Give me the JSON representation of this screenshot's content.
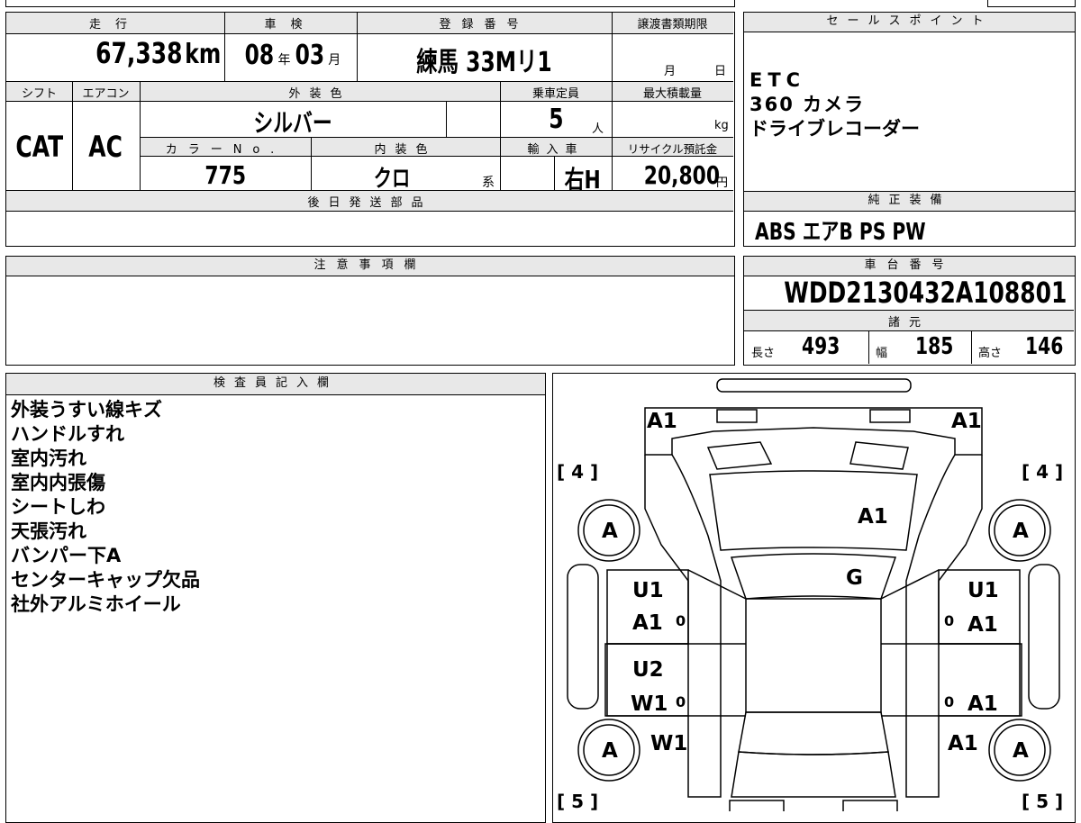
{
  "main": {
    "mileage_label": "走行",
    "mileage": "67,338",
    "mileage_unit": "km",
    "inspection_label": "車検",
    "inspection_year": "08",
    "year_unit": "年",
    "inspection_month": "03",
    "month_unit": "月",
    "registration_label": "登録番号",
    "registration": "練馬 33Mリ1",
    "transfer_deadline_label": "譲渡書類期限",
    "transfer_month_unit": "月",
    "transfer_day_unit": "日",
    "shift_label": "シフト",
    "shift": "CAT",
    "aircon_label": "エアコン",
    "aircon": "AC",
    "exterior_color_label": "外装色",
    "exterior_color": "シルバー",
    "capacity_label": "乗車定員",
    "capacity": "5",
    "capacity_unit": "人",
    "max_load_label": "最大積載量",
    "max_load_unit": "kg",
    "color_no_label": "カラーNo.",
    "color_no": "775",
    "interior_color_label": "内装色",
    "interior_color": "クロ",
    "interior_suffix": "系",
    "import_label": "輸入車",
    "import_value": "右H",
    "recycle_label": "リサイクル預託金",
    "recycle_fee": "20,800",
    "recycle_unit": "円",
    "later_parts_label": "後日発送部品"
  },
  "sales_points": {
    "label": "セールスポイント",
    "lines": [
      "ETC",
      "360 カメラ",
      "ドライブレコーダー"
    ]
  },
  "equipment": {
    "label": "純正装備",
    "value": "ABS エアB PS PW"
  },
  "caution": {
    "label": "注意事項欄"
  },
  "chassis": {
    "label": "車台番号",
    "value": "WDD2130432A108801",
    "specs_label": "諸元",
    "length_label": "長さ",
    "length": "493",
    "width_label": "幅",
    "width": "185",
    "height_label": "高さ",
    "height": "146"
  },
  "inspector": {
    "label": "検査員記入欄",
    "lines": [
      "外装うすい線キズ",
      "ハンドルすれ",
      "室内汚れ",
      "室内内張傷",
      "シートしわ",
      "天張汚れ",
      "バンパー下A",
      "センターキャップ欠品",
      "社外アルミホイール"
    ]
  },
  "diagram": {
    "marks": {
      "front_left": "A1",
      "front_right": "A1",
      "hood": "A1",
      "windshield": "G",
      "lf_door_top": "U1",
      "lf_door_bottom": "A1",
      "rf_door_top": "U1",
      "rf_door_bottom": "A1",
      "lr_door_top": "U2",
      "lr_door_bottom": "W1",
      "rr_door_bottom": "A1",
      "rear_left": "W1",
      "rear_right": "A1",
      "wheel_fl": "A",
      "wheel_fr": "A",
      "wheel_rl": "A",
      "wheel_rr": "A",
      "tire_front_left": "[ 4 ]",
      "tire_front_right": "[ 4 ]",
      "tire_rear_left": "[ 5 ]",
      "tire_rear_right": "[ 5 ]",
      "zero": "0"
    }
  }
}
